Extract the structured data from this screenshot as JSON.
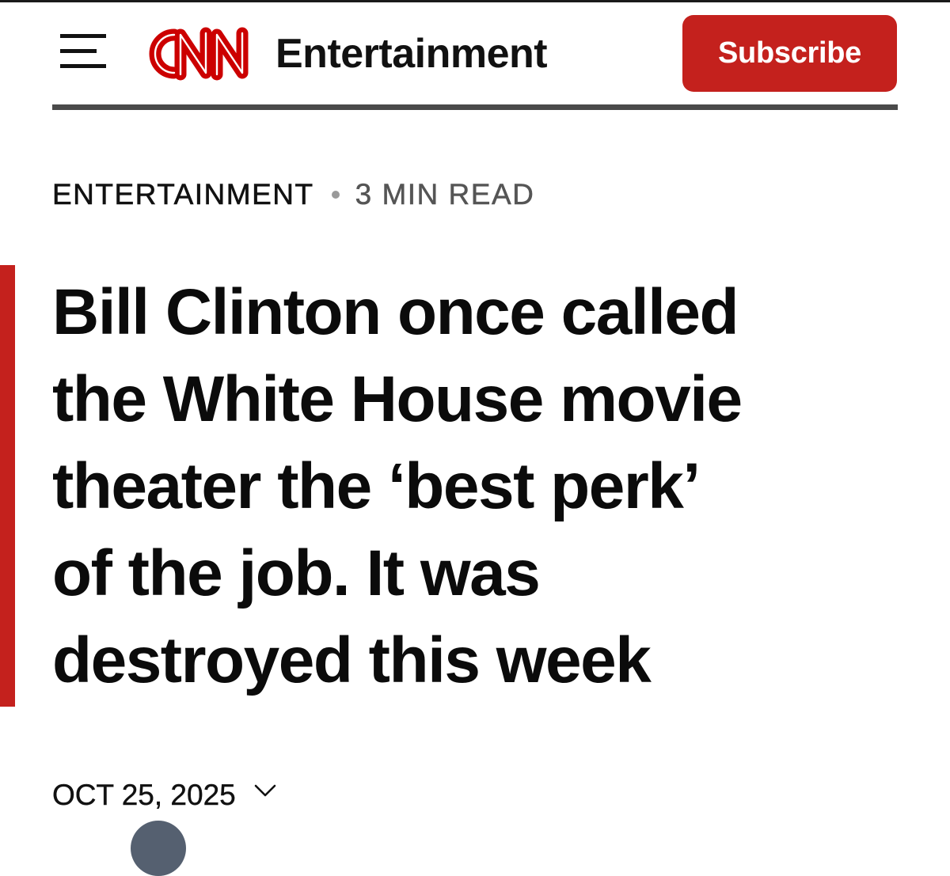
{
  "header": {
    "brand": "CNN",
    "section": "Entertainment",
    "subscribe_label": "Subscribe",
    "menu_icon": "hamburger-menu-icon",
    "accent_color": "#c4211d"
  },
  "article": {
    "category": "ENTERTAINMENT",
    "read_time": "3 MIN READ",
    "headline_lines": [
      "Bill Clinton once called",
      "the White House movie",
      "theater the ‘best perk’",
      "of the job. It was",
      "destroyed this week"
    ],
    "date": "OCT 25, 2025",
    "date_toggle_icon": "chevron-down-icon"
  }
}
